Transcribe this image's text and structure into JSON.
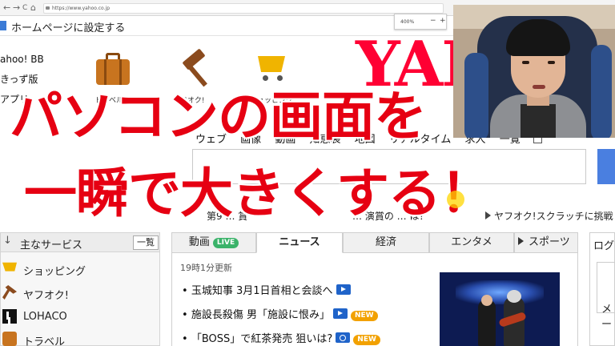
{
  "browser": {
    "url": "https://www.yahoo.co.jp",
    "zoom": "400%",
    "zoom_minus": "−",
    "zoom_plus": "+",
    "nav_back": "←",
    "nav_forward": "→",
    "nav_reload": "C",
    "nav_home": "⌂"
  },
  "homebar": {
    "label": "ホームページに設定する"
  },
  "left_links": [
    "ahoo! BB",
    "きっず版",
    "アプリ"
  ],
  "services": [
    {
      "label": "トラベル",
      "icon": "suitcase-icon"
    },
    {
      "label": "ヤフオク!",
      "icon": "gavel-icon"
    },
    {
      "label": "ショッピング",
      "icon": "cart-icon"
    }
  ],
  "logo": {
    "text": "YAH"
  },
  "search": {
    "tabs": [
      "ウェブ",
      "画像",
      "動画",
      "知恵袋",
      "地図",
      "リアルタイム",
      "求人",
      "一覧"
    ]
  },
  "pickup": {
    "item1": "第9 … 賞",
    "item2": "… 演賞の … は？",
    "item3": "ヤフオク!スクラッチに挑戦"
  },
  "sidebar": {
    "title": "主なサービス",
    "all_button": "一覧",
    "items": [
      {
        "label": "ショッピング",
        "icon": "cart-icon"
      },
      {
        "label": "ヤフオク!",
        "icon": "gavel-icon"
      },
      {
        "label": "LOHACO",
        "icon": "lohaco-icon"
      },
      {
        "label": "トラベル",
        "icon": "suitcase-icon"
      }
    ]
  },
  "news": {
    "tabs": [
      {
        "label": "動画",
        "badge": "LIVE"
      },
      {
        "label": "ニュース"
      },
      {
        "label": "経済"
      },
      {
        "label": "エンタメ"
      },
      {
        "label": "スポーツ"
      }
    ],
    "updated": "19時1分更新",
    "items": [
      {
        "text": "玉城知事 3月1日首相と会談へ",
        "media": "video-icon",
        "new": ""
      },
      {
        "text": "施設長殺傷 男「施設に恨み」",
        "media": "video-icon",
        "new": "NEW"
      },
      {
        "text": "「BOSS」で紅茶発売 狙いは?",
        "media": "camera-icon",
        "new": "NEW"
      }
    ]
  },
  "right_panel": {
    "title": "ログ",
    "item": "メー"
  },
  "overlay": {
    "line1": "パソコンの画面を",
    "line2": "一瞬で大きくする！"
  },
  "colors": {
    "accent_red": "#e60012",
    "yahoo_red": "#ff0033",
    "live_green": "#3bb36a",
    "new_orange": "#f2a100"
  }
}
